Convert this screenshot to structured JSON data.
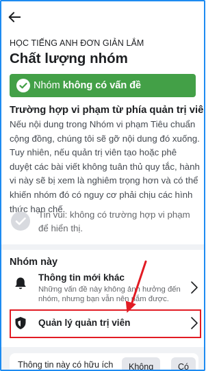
{
  "header": {
    "back_icon": "arrow-left-icon"
  },
  "group": {
    "name": "HỌC TIẾNG ANH ĐƠN GIẢN LẮM"
  },
  "page": {
    "title": "Chất lượng nhóm"
  },
  "status": {
    "prefix": "Nhóm ",
    "bold": "không có vấn đề",
    "icon": "check-circle-icon",
    "color": "#43a047"
  },
  "admin_violations": {
    "title": "Trường hợp vi phạm từ phía quản trị viên",
    "description": "Nếu nội dung trong Nhóm vi phạm Tiêu chuẩn cộng đồng, chúng tôi sẽ gỡ nội dung đó xuống. Tuy nhiên, nếu quản trị viên tạo hoặc phê duyệt các bài viết không tuân thủ quy tắc, hành vi này sẽ bị xem là nghiêm trọng hơn và có thể khiến nhóm đó có nguy cơ phải chịu các hình thức hạn chế.",
    "good_news": "Tin vui: không có trường hợp vi phạm để hiển thị.",
    "good_news_icon": "check-circle-icon"
  },
  "this_group": {
    "title": "Nhóm này",
    "items": [
      {
        "title": "Thông tin mới khác",
        "description": "Những vấn đề này không ảnh hưởng đến nhóm, nhưng bạn vẫn nên nắm được.",
        "icon": "bell-icon"
      },
      {
        "title": "Quản lý quản trị viên",
        "icon": "shield-icon"
      }
    ]
  },
  "feedback": {
    "question": "Thông tin này có hữu ích",
    "no": "Không",
    "yes": "Có"
  },
  "colors": {
    "accent_frame": "#1d8bf1",
    "highlight": "#e21b23"
  }
}
